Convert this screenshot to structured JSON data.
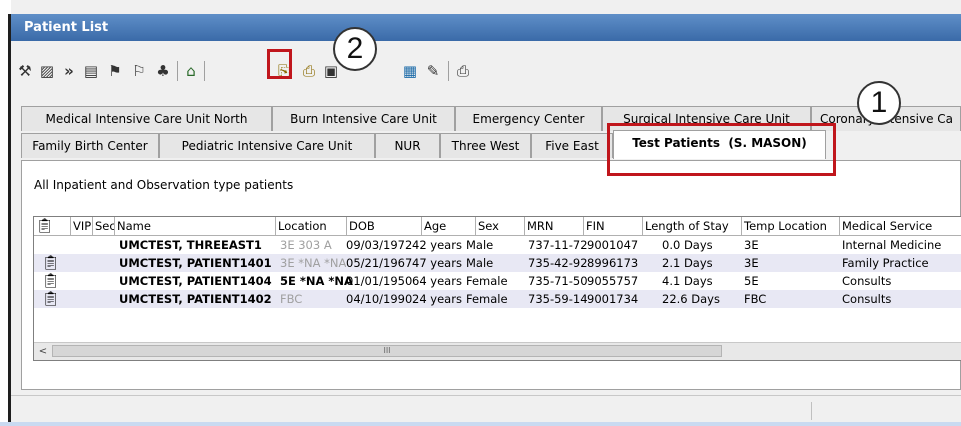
{
  "window": {
    "title": "Patient List"
  },
  "toolbar": {
    "icons": [
      "wrench-icon",
      "properties-icon",
      "double-chevron-right-icon",
      "view-list-icon",
      "person-filter-icon",
      "person-remove-icon",
      "group-icon",
      "home-icon",
      "clipboard-icon",
      "clipboard-paste-icon",
      "print-preview-icon",
      "calendar-icon",
      "document-edit-icon",
      "print-icon"
    ]
  },
  "tabs_row1": [
    "Medical Intensive Care Unit North",
    "Burn Intensive Care Unit",
    "Emergency Center",
    "Surgical Intensive Care Unit",
    "Coronary Intensive Ca"
  ],
  "tabs_row2": [
    "Family Birth Center",
    "Pediatric Intensive Care Unit",
    "NUR",
    "Three West",
    "Five East",
    "Test Patients  (S. MASON)"
  ],
  "filter_label": "All Inpatient and Observation type patients",
  "grid": {
    "columns": [
      "",
      "VIP",
      "Sec",
      "Name",
      "Location",
      "DOB",
      "Age",
      "Sex",
      "MRN",
      "FIN",
      "Length of Stay",
      "Temp Location",
      "Medical Service"
    ],
    "rows": [
      {
        "icon": false,
        "name": "UMCTEST, THREEAST1",
        "location": "3E 303 A",
        "dob": "09/03/1972",
        "age": "42 years",
        "sex": "Male",
        "mrn": "737-11-72",
        "fin": "9001047",
        "los": "0.0 Days",
        "temp": "3E",
        "service": "Internal Medicine"
      },
      {
        "icon": true,
        "name": "UMCTEST, PATIENT1401",
        "location": "3E *NA *NA",
        "dob": "05/21/1967",
        "age": "47 years",
        "sex": "Male",
        "mrn": "735-42-92",
        "fin": "8996173",
        "los": "2.1 Days",
        "temp": "3E",
        "service": "Family Practice"
      },
      {
        "icon": true,
        "name": "UMCTEST, PATIENT1404",
        "location": "5E *NA *NA",
        "dob": "01/01/1950",
        "age": "64 years",
        "sex": "Female",
        "mrn": "735-71-50",
        "fin": "9055757",
        "los": "4.1 Days",
        "temp": "5E",
        "service": "Consults"
      },
      {
        "icon": true,
        "name": "UMCTEST, PATIENT1402",
        "location": "FBC",
        "dob": "04/10/1990",
        "age": "24 years",
        "sex": "Female",
        "mrn": "735-59-14",
        "fin": "9001734",
        "los": "22.6 Days",
        "temp": "FBC",
        "service": "Consults"
      }
    ]
  },
  "scrollbar": {
    "left_arrow": "<",
    "thumb_grip": "III"
  },
  "callouts": {
    "one": "1",
    "two": "2"
  },
  "colors": {
    "titlebar": "#4a7ab8",
    "callout_box": "#c0161c",
    "alt_row": "#e8e8f4"
  }
}
